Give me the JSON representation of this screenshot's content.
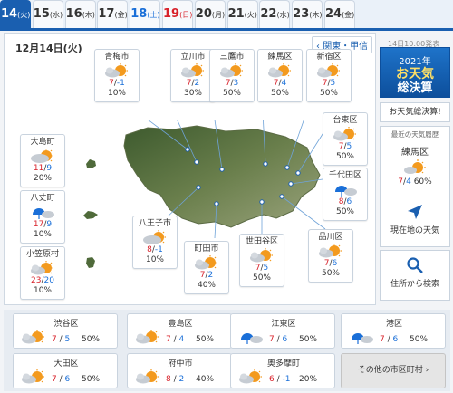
{
  "date_tabs": [
    {
      "day": "14",
      "weekday": "(火)"
    },
    {
      "day": "15",
      "weekday": "(水)"
    },
    {
      "day": "16",
      "weekday": "(木)"
    },
    {
      "day": "17",
      "weekday": "(金)"
    },
    {
      "day": "18",
      "weekday": "(土)"
    },
    {
      "day": "19",
      "weekday": "(日)"
    },
    {
      "day": "20",
      "weekday": "(月)"
    },
    {
      "day": "21",
      "weekday": "(火)"
    },
    {
      "day": "22",
      "weekday": "(水)"
    },
    {
      "day": "23",
      "weekday": "(木)"
    },
    {
      "day": "24",
      "weekday": "(金)"
    }
  ],
  "header": {
    "date_label": "12月14日(火)",
    "region_button": "関東・甲信",
    "updated": "14日10:00発表"
  },
  "cities": [
    {
      "name": "青梅市",
      "weather": "sunny-cloudy",
      "high": "7",
      "low": "-1",
      "pop": "10%"
    },
    {
      "name": "立川市",
      "weather": "sunny-cloudy",
      "high": "7",
      "low": "2",
      "pop": "30%"
    },
    {
      "name": "三鷹市",
      "weather": "sunny-cloudy",
      "high": "7",
      "low": "3",
      "pop": "50%"
    },
    {
      "name": "練馬区",
      "weather": "sunny-cloudy",
      "high": "7",
      "low": "4",
      "pop": "50%"
    },
    {
      "name": "新宿区",
      "weather": "sunny-cloudy",
      "high": "7",
      "low": "5",
      "pop": "50%"
    },
    {
      "name": "台東区",
      "weather": "sunny-cloudy",
      "high": "7",
      "low": "5",
      "pop": "50%"
    },
    {
      "name": "千代田区",
      "weather": "cloudy-rainy",
      "high": "8",
      "low": "6",
      "pop": "50%"
    },
    {
      "name": "品川区",
      "weather": "sunny-cloudy",
      "high": "7",
      "low": "6",
      "pop": "50%"
    },
    {
      "name": "世田谷区",
      "weather": "sunny-cloudy",
      "high": "7",
      "low": "5",
      "pop": "50%"
    },
    {
      "name": "町田市",
      "weather": "sunny-cloudy",
      "high": "7",
      "low": "2",
      "pop": "40%"
    },
    {
      "name": "八王子市",
      "weather": "cloudy-sunny",
      "high": "8",
      "low": "-1",
      "pop": "10%"
    },
    {
      "name": "大島町",
      "weather": "cloudy-sunny",
      "high": "11",
      "low": "9",
      "pop": "20%"
    },
    {
      "name": "八丈町",
      "weather": "cloudy-rainy",
      "high": "17",
      "low": "9",
      "pop": "10%"
    },
    {
      "name": "小笠原村",
      "weather": "sunny-cloudy",
      "high": "23",
      "low": "20",
      "pop": "10%"
    }
  ],
  "sidebar": {
    "banner_year": "2021年",
    "banner_line1": "お天気",
    "banner_line2": "総決算",
    "summary_link": "お天気総決算!",
    "history_title": "最近の天気履歴",
    "history_city": "練馬区",
    "history_high": "7",
    "history_low": "4",
    "history_pop": "60%",
    "current_location": "現在地の天気",
    "address_search": "住所から検索"
  },
  "bottom_cities": [
    {
      "name": "渋谷区",
      "weather": "sunny-cloudy",
      "high": "7",
      "low": "5",
      "pop": "50%"
    },
    {
      "name": "豊島区",
      "weather": "sunny-cloudy",
      "high": "7",
      "low": "4",
      "pop": "50%"
    },
    {
      "name": "江東区",
      "weather": "cloudy-rainy",
      "high": "7",
      "low": "6",
      "pop": "50%"
    },
    {
      "name": "港区",
      "weather": "cloudy-rainy",
      "high": "7",
      "low": "6",
      "pop": "50%"
    },
    {
      "name": "大田区",
      "weather": "sunny-cloudy",
      "high": "7",
      "low": "6",
      "pop": "50%"
    },
    {
      "name": "府中市",
      "weather": "sunny-cloudy",
      "high": "8",
      "low": "2",
      "pop": "40%"
    },
    {
      "name": "奥多摩町",
      "weather": "sunny-cloudy",
      "high": "6",
      "low": "-1",
      "pop": "20%"
    }
  ],
  "bottom_more_button": "その他の市区町村",
  "colors": {
    "accent": "#1a5fb0",
    "high_temp": "#d8212a",
    "low_temp": "#1a6fd8",
    "saturday": "#1a6fd8",
    "sunday": "#d8212a"
  }
}
